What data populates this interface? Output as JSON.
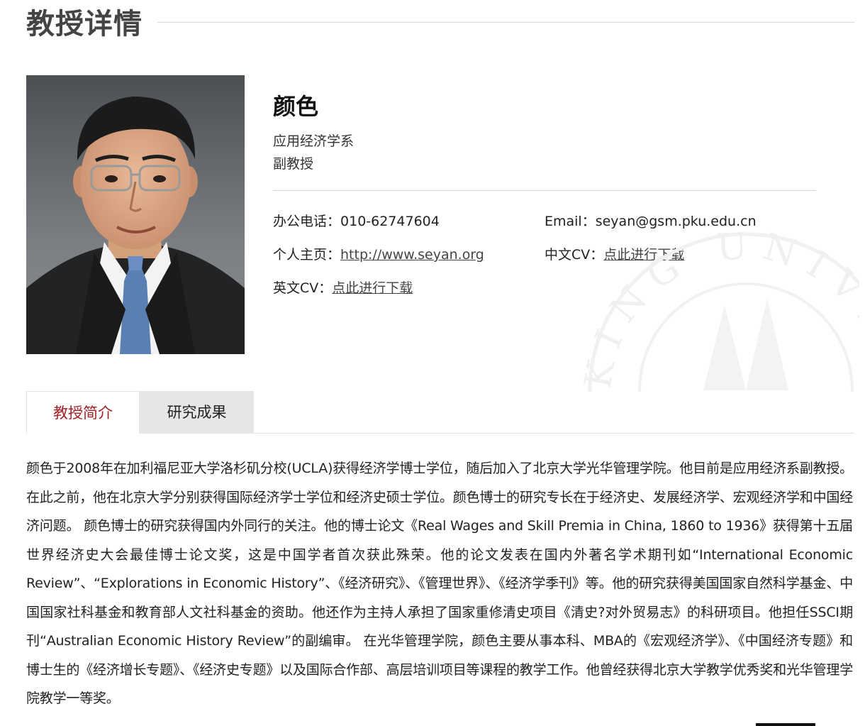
{
  "page": {
    "title": "教授详情"
  },
  "profile": {
    "name": "颜色",
    "department": "应用经济学系",
    "rank": "副教授",
    "photo_alt": "颜色"
  },
  "contact": {
    "phone_label": "办公电话：",
    "phone_value": "010-62747604",
    "email_label": "Email：",
    "email_value": "seyan@gsm.pku.edu.cn",
    "homepage_label": "个人主页：",
    "homepage_value": "http://www.seyan.org",
    "cn_cv_label": "中文CV：",
    "cn_cv_link": "点此进行下载",
    "en_cv_label": "英文CV：",
    "en_cv_link": "点此进行下载"
  },
  "tabs": [
    {
      "label": "教授简介",
      "active": true
    },
    {
      "label": "研究成果",
      "active": false
    }
  ],
  "bio": "颜色于2008年在加利福尼亚大学洛杉矶分校(UCLA)获得经济学博士学位，随后加入了北京大学光华管理学院。他目前是应用经济系副教授。在此之前，他在北京大学分别获得国际经济学士学位和经济史硕士学位。颜色博士的研究专长在于经济史、发展经济学、宏观经济学和中国经济问题。 颜色博士的研究获得国内外同行的关注。他的博士论文《Real Wages and Skill Premia in China, 1860 to 1936》获得第十五届世界经济史大会最佳博士论文奖，这是中国学者首次获此殊荣。他的论文发表在国内外著名学术期刊如“International Economic Review”、“Explorations in Economic History”、《经济研究》、《管理世界》、《经济学季刊》等。他的研究获得美国国家自然科学基金、中国国家社科基金和教育部人文社科基金的资助。他还作为主持人承担了国家重修清史项目《清史?对外贸易志》的科研项目。他担任SSCI期刊“Australian Economic History Review”的副编审。 在光华管理学院，颜色主要从事本科、MBA的《宏观经济学》、《中国经济专题》和博士生的《经济增长专题》、《经济史专题》以及国际合作部、高层培训项目等课程的教学工作。他曾经获得北京大学教学优秀奖和光华管理学院教学一等奖。",
  "seal": {
    "text": "KING UNIVE"
  },
  "colors": {
    "accent": "#a31f24",
    "tab_inactive_bg": "#e6e6e6",
    "title_text": "#444444"
  }
}
